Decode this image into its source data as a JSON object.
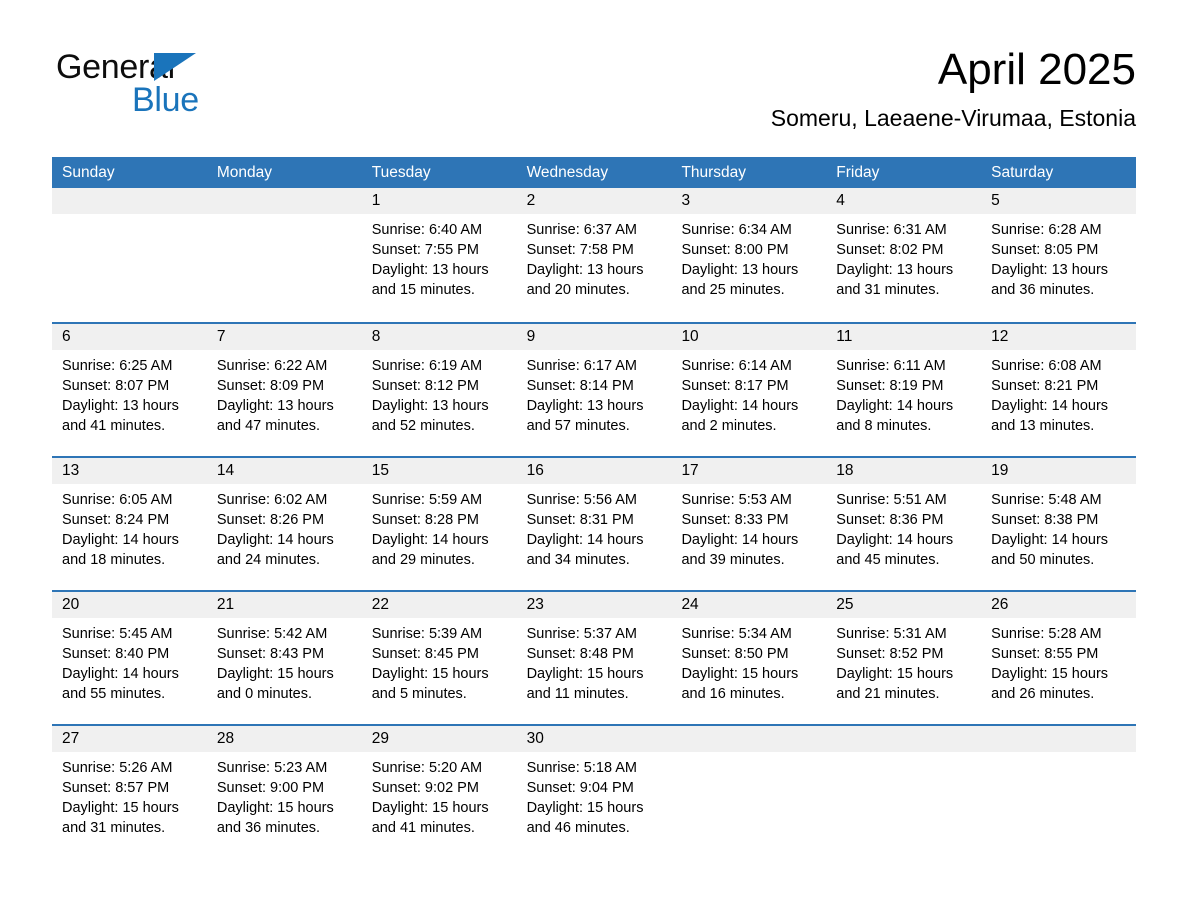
{
  "brand": {
    "line1": "General",
    "line2": "Blue",
    "triangle_color": "#1a74bb",
    "text_color": "#0d0d0d"
  },
  "header": {
    "month_title": "April 2025",
    "location": "Someru, Laeaene-Virumaa, Estonia"
  },
  "theme": {
    "header_blue": "#2e75b6",
    "day_band_gray": "#f0f0f0",
    "row_divider": "#2e75b6"
  },
  "weekdays": [
    "Sunday",
    "Monday",
    "Tuesday",
    "Wednesday",
    "Thursday",
    "Friday",
    "Saturday"
  ],
  "weeks": [
    [
      {
        "day": "",
        "empty": true
      },
      {
        "day": "",
        "empty": true
      },
      {
        "day": "1",
        "sunrise": "Sunrise: 6:40 AM",
        "sunset": "Sunset: 7:55 PM",
        "daylight1": "Daylight: 13 hours",
        "daylight2": "and 15 minutes."
      },
      {
        "day": "2",
        "sunrise": "Sunrise: 6:37 AM",
        "sunset": "Sunset: 7:58 PM",
        "daylight1": "Daylight: 13 hours",
        "daylight2": "and 20 minutes."
      },
      {
        "day": "3",
        "sunrise": "Sunrise: 6:34 AM",
        "sunset": "Sunset: 8:00 PM",
        "daylight1": "Daylight: 13 hours",
        "daylight2": "and 25 minutes."
      },
      {
        "day": "4",
        "sunrise": "Sunrise: 6:31 AM",
        "sunset": "Sunset: 8:02 PM",
        "daylight1": "Daylight: 13 hours",
        "daylight2": "and 31 minutes."
      },
      {
        "day": "5",
        "sunrise": "Sunrise: 6:28 AM",
        "sunset": "Sunset: 8:05 PM",
        "daylight1": "Daylight: 13 hours",
        "daylight2": "and 36 minutes."
      }
    ],
    [
      {
        "day": "6",
        "sunrise": "Sunrise: 6:25 AM",
        "sunset": "Sunset: 8:07 PM",
        "daylight1": "Daylight: 13 hours",
        "daylight2": "and 41 minutes."
      },
      {
        "day": "7",
        "sunrise": "Sunrise: 6:22 AM",
        "sunset": "Sunset: 8:09 PM",
        "daylight1": "Daylight: 13 hours",
        "daylight2": "and 47 minutes."
      },
      {
        "day": "8",
        "sunrise": "Sunrise: 6:19 AM",
        "sunset": "Sunset: 8:12 PM",
        "daylight1": "Daylight: 13 hours",
        "daylight2": "and 52 minutes."
      },
      {
        "day": "9",
        "sunrise": "Sunrise: 6:17 AM",
        "sunset": "Sunset: 8:14 PM",
        "daylight1": "Daylight: 13 hours",
        "daylight2": "and 57 minutes."
      },
      {
        "day": "10",
        "sunrise": "Sunrise: 6:14 AM",
        "sunset": "Sunset: 8:17 PM",
        "daylight1": "Daylight: 14 hours",
        "daylight2": "and 2 minutes."
      },
      {
        "day": "11",
        "sunrise": "Sunrise: 6:11 AM",
        "sunset": "Sunset: 8:19 PM",
        "daylight1": "Daylight: 14 hours",
        "daylight2": "and 8 minutes."
      },
      {
        "day": "12",
        "sunrise": "Sunrise: 6:08 AM",
        "sunset": "Sunset: 8:21 PM",
        "daylight1": "Daylight: 14 hours",
        "daylight2": "and 13 minutes."
      }
    ],
    [
      {
        "day": "13",
        "sunrise": "Sunrise: 6:05 AM",
        "sunset": "Sunset: 8:24 PM",
        "daylight1": "Daylight: 14 hours",
        "daylight2": "and 18 minutes."
      },
      {
        "day": "14",
        "sunrise": "Sunrise: 6:02 AM",
        "sunset": "Sunset: 8:26 PM",
        "daylight1": "Daylight: 14 hours",
        "daylight2": "and 24 minutes."
      },
      {
        "day": "15",
        "sunrise": "Sunrise: 5:59 AM",
        "sunset": "Sunset: 8:28 PM",
        "daylight1": "Daylight: 14 hours",
        "daylight2": "and 29 minutes."
      },
      {
        "day": "16",
        "sunrise": "Sunrise: 5:56 AM",
        "sunset": "Sunset: 8:31 PM",
        "daylight1": "Daylight: 14 hours",
        "daylight2": "and 34 minutes."
      },
      {
        "day": "17",
        "sunrise": "Sunrise: 5:53 AM",
        "sunset": "Sunset: 8:33 PM",
        "daylight1": "Daylight: 14 hours",
        "daylight2": "and 39 minutes."
      },
      {
        "day": "18",
        "sunrise": "Sunrise: 5:51 AM",
        "sunset": "Sunset: 8:36 PM",
        "daylight1": "Daylight: 14 hours",
        "daylight2": "and 45 minutes."
      },
      {
        "day": "19",
        "sunrise": "Sunrise: 5:48 AM",
        "sunset": "Sunset: 8:38 PM",
        "daylight1": "Daylight: 14 hours",
        "daylight2": "and 50 minutes."
      }
    ],
    [
      {
        "day": "20",
        "sunrise": "Sunrise: 5:45 AM",
        "sunset": "Sunset: 8:40 PM",
        "daylight1": "Daylight: 14 hours",
        "daylight2": "and 55 minutes."
      },
      {
        "day": "21",
        "sunrise": "Sunrise: 5:42 AM",
        "sunset": "Sunset: 8:43 PM",
        "daylight1": "Daylight: 15 hours",
        "daylight2": "and 0 minutes."
      },
      {
        "day": "22",
        "sunrise": "Sunrise: 5:39 AM",
        "sunset": "Sunset: 8:45 PM",
        "daylight1": "Daylight: 15 hours",
        "daylight2": "and 5 minutes."
      },
      {
        "day": "23",
        "sunrise": "Sunrise: 5:37 AM",
        "sunset": "Sunset: 8:48 PM",
        "daylight1": "Daylight: 15 hours",
        "daylight2": "and 11 minutes."
      },
      {
        "day": "24",
        "sunrise": "Sunrise: 5:34 AM",
        "sunset": "Sunset: 8:50 PM",
        "daylight1": "Daylight: 15 hours",
        "daylight2": "and 16 minutes."
      },
      {
        "day": "25",
        "sunrise": "Sunrise: 5:31 AM",
        "sunset": "Sunset: 8:52 PM",
        "daylight1": "Daylight: 15 hours",
        "daylight2": "and 21 minutes."
      },
      {
        "day": "26",
        "sunrise": "Sunrise: 5:28 AM",
        "sunset": "Sunset: 8:55 PM",
        "daylight1": "Daylight: 15 hours",
        "daylight2": "and 26 minutes."
      }
    ],
    [
      {
        "day": "27",
        "sunrise": "Sunrise: 5:26 AM",
        "sunset": "Sunset: 8:57 PM",
        "daylight1": "Daylight: 15 hours",
        "daylight2": "and 31 minutes."
      },
      {
        "day": "28",
        "sunrise": "Sunrise: 5:23 AM",
        "sunset": "Sunset: 9:00 PM",
        "daylight1": "Daylight: 15 hours",
        "daylight2": "and 36 minutes."
      },
      {
        "day": "29",
        "sunrise": "Sunrise: 5:20 AM",
        "sunset": "Sunset: 9:02 PM",
        "daylight1": "Daylight: 15 hours",
        "daylight2": "and 41 minutes."
      },
      {
        "day": "30",
        "sunrise": "Sunrise: 5:18 AM",
        "sunset": "Sunset: 9:04 PM",
        "daylight1": "Daylight: 15 hours",
        "daylight2": "and 46 minutes."
      },
      {
        "day": "",
        "empty": true
      },
      {
        "day": "",
        "empty": true
      },
      {
        "day": "",
        "empty": true
      }
    ]
  ]
}
